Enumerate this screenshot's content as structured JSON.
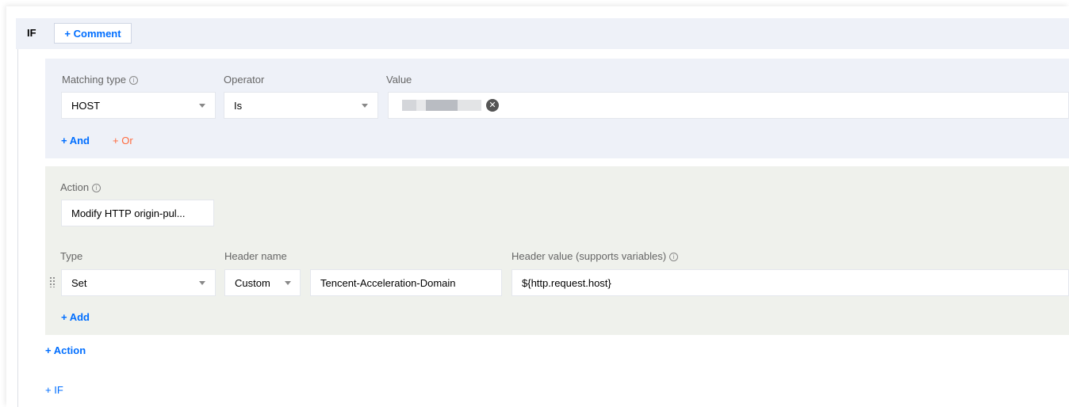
{
  "rule": {
    "if_label": "IF",
    "comment_button": "+ Comment"
  },
  "condition": {
    "matching_type_label": "Matching type",
    "operator_label": "Operator",
    "value_label": "Value",
    "matching_type_value": "HOST",
    "operator_value": "Is",
    "and_link": "+ And",
    "or_link": "+ Or"
  },
  "action": {
    "action_label": "Action",
    "action_value": "Modify HTTP origin-pul...",
    "type_label": "Type",
    "header_name_label": "Header name",
    "header_value_label": "Header value (supports variables)",
    "type_value": "Set",
    "header_name_mode": "Custom",
    "header_name_value": "Tencent-Acceleration-Domain",
    "header_value": "${http.request.host}",
    "add_link": "+ Add"
  },
  "footer": {
    "add_action_link": "+ Action",
    "add_if_link": "+ IF"
  },
  "icons": {
    "info": "info-icon",
    "dropdown": "chevron-down-icon",
    "clear": "close-circle-icon",
    "drag": "drag-handle-icon"
  },
  "colors": {
    "accent": "#006eff",
    "or_link": "#ff6a3d",
    "condition_bg": "#eef1f8",
    "action_bg": "#eff1ec"
  }
}
